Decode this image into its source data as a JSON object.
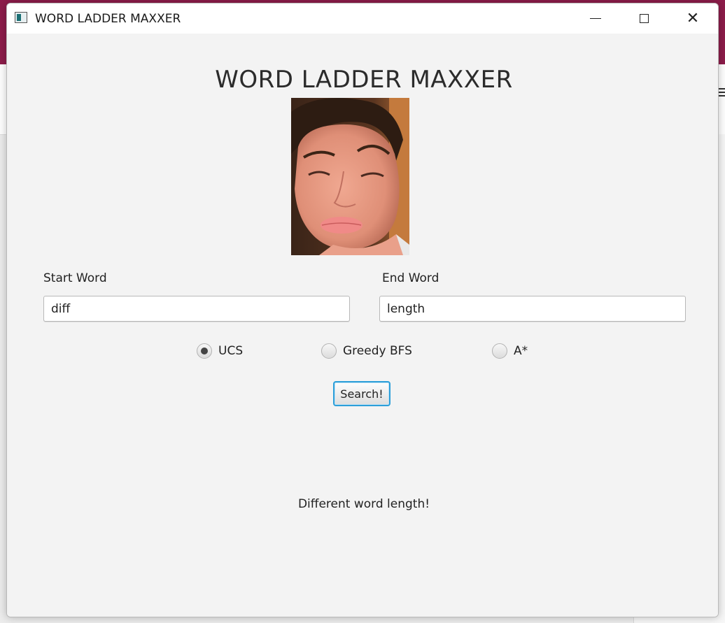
{
  "window": {
    "title": "WORD LADDER MAXXER"
  },
  "main": {
    "heading": "WORD LADDER MAXXER",
    "start_word": {
      "label": "Start Word",
      "value": "diff"
    },
    "end_word": {
      "label": "End Word",
      "value": "length"
    },
    "algorithms": [
      {
        "label": "UCS",
        "selected": true
      },
      {
        "label": "Greedy BFS",
        "selected": false
      },
      {
        "label": "A*",
        "selected": false
      }
    ],
    "search_button": "Search!",
    "result_message": "Different word length!"
  },
  "colors": {
    "window_background": "#f3f3f3",
    "button_focus_border": "#2d9fd9",
    "backdrop_accent": "#8d1c4a"
  },
  "icons": {
    "app": "app-icon",
    "minimize": "minimize-icon",
    "maximize": "maximize-icon",
    "close": "close-icon"
  }
}
